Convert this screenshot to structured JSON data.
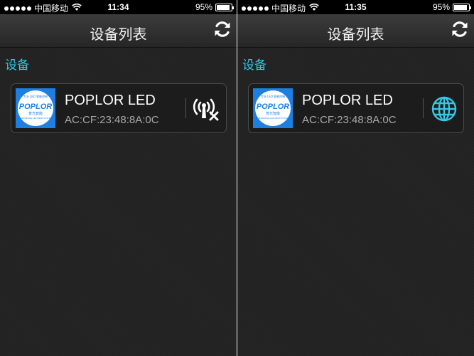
{
  "screens": [
    {
      "status_bar": {
        "carrier": "中国移动",
        "time": "11:34",
        "battery": "95%",
        "battery_level": 0.95
      },
      "nav": {
        "title": "设备列表",
        "refresh_icon": "refresh-icon"
      },
      "section_title": "设备",
      "device": {
        "name": "POPLOR LED",
        "mac": "AC:CF:23:48:8A:0C",
        "logo_text": "POPLOR",
        "logo_top_text": "专业 LED 智能控制",
        "logo_cn_text": "普光智能",
        "logo_sub_text": "PROFESSIONAL LED SMART SYSTEMS",
        "status_icon": "signal-disconnected-icon"
      }
    },
    {
      "status_bar": {
        "carrier": "中国移动",
        "time": "11:35",
        "battery": "95%",
        "battery_level": 0.95
      },
      "nav": {
        "title": "设备列表",
        "refresh_icon": "refresh-icon"
      },
      "section_title": "设备",
      "device": {
        "name": "POPLOR LED",
        "mac": "AC:CF:23:48:8A:0C",
        "logo_text": "POPLOR",
        "logo_top_text": "专业 LED 智能控制",
        "logo_cn_text": "普光智能",
        "logo_sub_text": "PROFESSIONAL LED SMART SYSTEMS",
        "status_icon": "globe-icon"
      }
    }
  ],
  "colors": {
    "accent": "#35c8e8",
    "logo_bg": "#1d7fe0",
    "background": "#222222"
  }
}
